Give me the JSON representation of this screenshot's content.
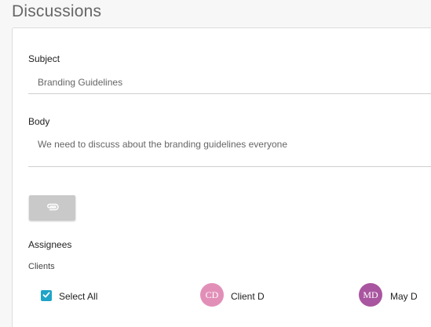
{
  "page": {
    "title": "Discussions"
  },
  "form": {
    "subject_label": "Subject",
    "subject_value": "Branding Guidelines",
    "body_label": "Body",
    "body_value": "We need to discuss about the branding guidelines everyone",
    "attach_icon": "paperclip-icon"
  },
  "assignees": {
    "heading": "Assignees",
    "group_label": "Clients",
    "select_all_label": "Select All",
    "select_all_checked": true,
    "people": [
      {
        "initials": "CD",
        "name": "Client D",
        "color": "#e28fb8"
      },
      {
        "initials": "MD",
        "name": "May D",
        "color": "#a9559f"
      }
    ]
  },
  "colors": {
    "accent": "#1fa3c7",
    "button_gray": "#c9c9c9"
  }
}
